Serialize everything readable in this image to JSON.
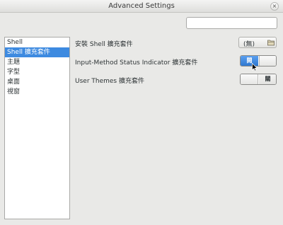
{
  "window": {
    "title": "Advanced Settings",
    "close_glyph": "×"
  },
  "search": {
    "value": "",
    "placeholder": ""
  },
  "sidebar": {
    "items": [
      {
        "label": "Shell",
        "selected": false
      },
      {
        "label": "Shell 擴充套件",
        "selected": true
      },
      {
        "label": "主題",
        "selected": false
      },
      {
        "label": "字型",
        "selected": false
      },
      {
        "label": "桌面",
        "selected": false
      },
      {
        "label": "視窗",
        "selected": false
      }
    ]
  },
  "settings": {
    "install_extension": {
      "label": "安裝 Shell 擴充套件",
      "button_label": "(無)",
      "icon": "folder-open-icon"
    },
    "input_method_indicator": {
      "label": "Input-Method Status Indicator 擴充套件",
      "state": "on",
      "on_text": "開"
    },
    "user_themes": {
      "label": "User Themes 擴充套件",
      "state": "off",
      "off_text": "關"
    }
  },
  "colors": {
    "accent": "#3d8ae0",
    "background": "#e9e9e7"
  }
}
